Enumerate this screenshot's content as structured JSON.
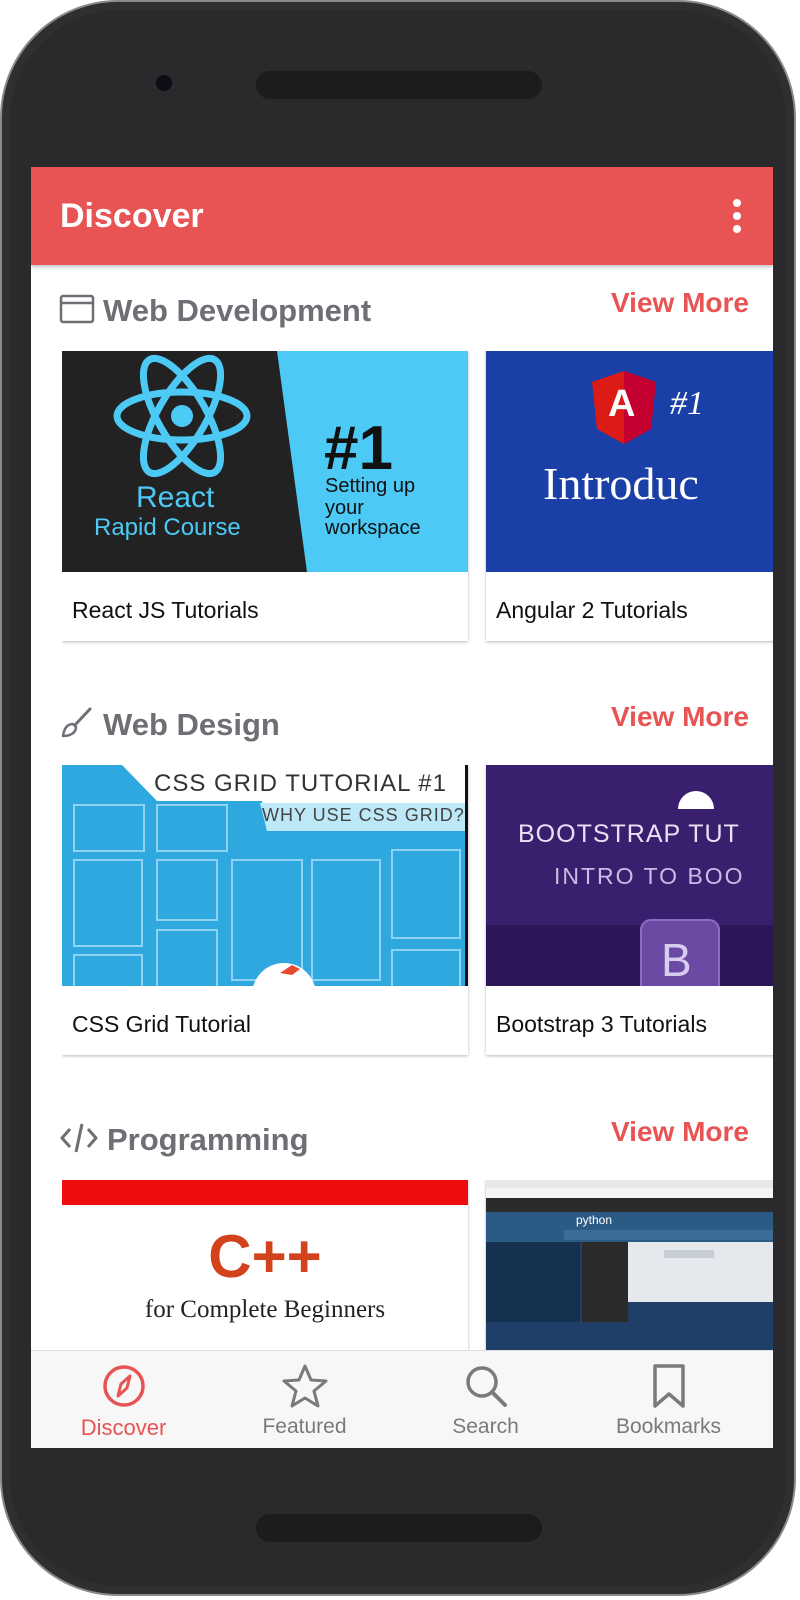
{
  "app": {
    "title": "Discover",
    "accent_color": "#e85353"
  },
  "sections": [
    {
      "title": "Web Development",
      "icon": "browser-window-icon",
      "view_more": "View More",
      "cards": [
        {
          "label": "React JS Tutorials",
          "thumb": {
            "line1": "React",
            "line2": "Rapid Course",
            "num": "#1",
            "sub1": "Setting up",
            "sub2": "your",
            "sub3": "workspace"
          }
        },
        {
          "label": "Angular 2 Tutorials",
          "thumb": {
            "logo": "A",
            "num": "#1",
            "text": "Introduc"
          }
        }
      ]
    },
    {
      "title": "Web Design",
      "icon": "paintbrush-icon",
      "view_more": "View More",
      "cards": [
        {
          "label": "CSS Grid Tutorial",
          "thumb": {
            "title": "CSS GRID TUTORIAL #1",
            "subtitle": "WHY USE CSS GRID?"
          }
        },
        {
          "label": "Bootstrap 3 Tutorials",
          "thumb": {
            "title": "BOOTSTRAP TUT",
            "subtitle": "INTRO TO BOO",
            "logo": "B"
          }
        }
      ]
    },
    {
      "title": "Programming",
      "icon": "code-icon",
      "view_more": "View More",
      "cards": [
        {
          "thumb": {
            "title": "C++",
            "subtitle": "for Complete Beginners"
          }
        },
        {
          "thumb": {
            "logo": "python"
          }
        }
      ]
    }
  ],
  "bottom_nav": [
    {
      "label": "Discover",
      "icon": "compass-icon",
      "active": true
    },
    {
      "label": "Featured",
      "icon": "star-icon",
      "active": false
    },
    {
      "label": "Search",
      "icon": "search-icon",
      "active": false
    },
    {
      "label": "Bookmarks",
      "icon": "bookmark-icon",
      "active": false
    }
  ]
}
